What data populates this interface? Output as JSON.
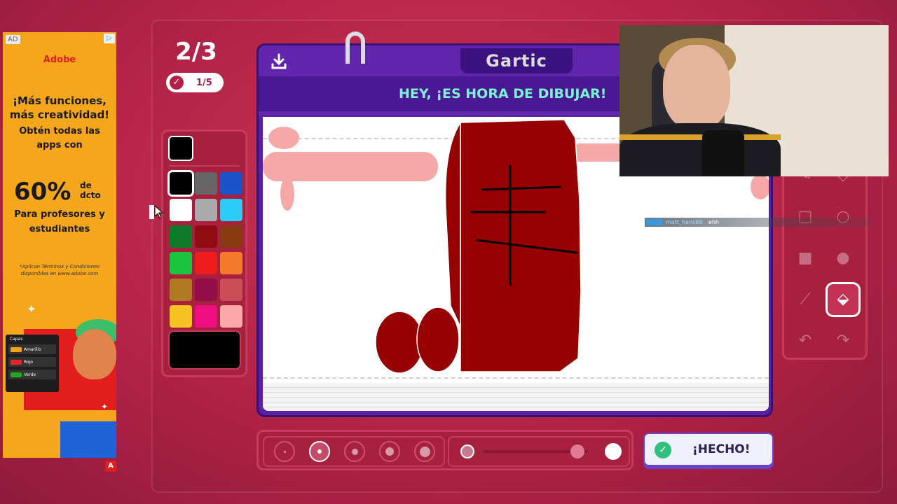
{
  "ad": {
    "tag": "AD",
    "brand": "Adobe",
    "headline": "¡Más funciones, más creatividad!",
    "subheadline": "Obtén todas las apps con",
    "discount": "60%",
    "discount_suffix": "de dcto",
    "audience": "Para profesores y estudiantes",
    "fineprint": "*Aplican Términos y Condiciones disponibles en www.adobe.com",
    "mini_panel": [
      "Capas",
      "Amarillo",
      "Rojo",
      "Verde"
    ],
    "badge": "A"
  },
  "round": {
    "current": "2/3",
    "progress": "1/5"
  },
  "palette": {
    "current_color": "#000000",
    "colors": [
      "#000000",
      "#666666",
      "#1a52c9",
      "#ffffff",
      "#aaaaaa",
      "#2bcdf6",
      "#0f7a2a",
      "#8f0c14",
      "#8a3b12",
      "#1bc43c",
      "#ee1c1c",
      "#f37a2b",
      "#b07a22",
      "#930e48",
      "#c94e57",
      "#f7c122",
      "#ee0e7f",
      "#f9a8a7"
    ],
    "selected_index": 0,
    "custom_color": "#000000"
  },
  "board": {
    "logo": "Gartic",
    "banner": "HEY, ¡ES HORA DE DIBUJAR!",
    "download_icon": "download-icon",
    "drawing_colors": {
      "bag": "#960000",
      "pink": "#f6a8a8",
      "lines": "#000000"
    }
  },
  "tools": [
    {
      "name": "pencil-icon",
      "glyph": "✎"
    },
    {
      "name": "eraser-icon",
      "glyph": "◇"
    },
    {
      "name": "rectangle-outline-icon",
      "glyph": "□"
    },
    {
      "name": "circle-outline-icon",
      "glyph": "○"
    },
    {
      "name": "rectangle-filled-icon",
      "glyph": "■"
    },
    {
      "name": "circle-filled-icon",
      "glyph": "●"
    },
    {
      "name": "line-icon",
      "glyph": "⟋"
    },
    {
      "name": "bucket-fill-icon",
      "glyph": "⬙"
    },
    {
      "name": "undo-icon",
      "glyph": "↶"
    },
    {
      "name": "redo-icon",
      "glyph": "↷"
    }
  ],
  "active_tool": 7,
  "brush_sizes": {
    "count": 5,
    "selected": 1
  },
  "opacity": {
    "value": 0.9
  },
  "done_button": {
    "label": "¡HECHO!"
  },
  "chat": {
    "user": "matt_hans88",
    "message": "ehh"
  }
}
